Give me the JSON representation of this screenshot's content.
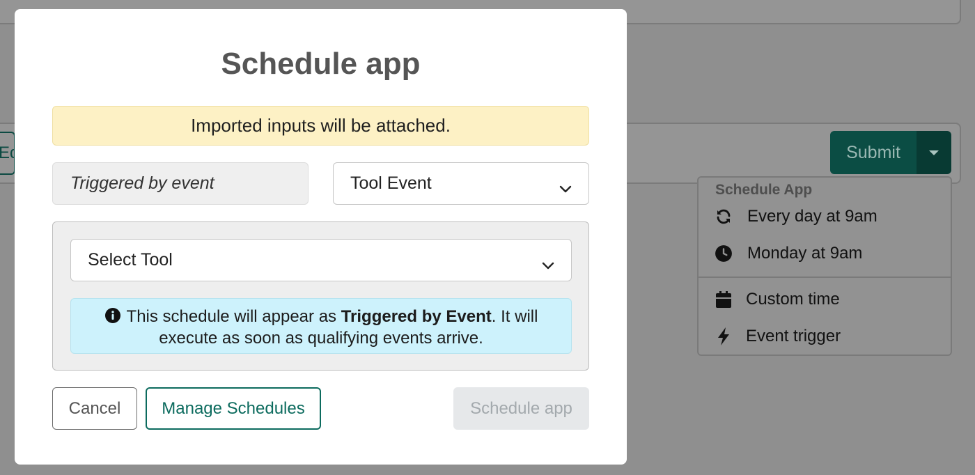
{
  "background": {
    "edit_button_label": "Edit",
    "submit_label": "Submit",
    "schedule_menu": {
      "header": "Schedule App",
      "items": [
        {
          "label": "Every day at 9am",
          "icon": "refresh-icon"
        },
        {
          "label": "Monday at 9am",
          "icon": "clock-icon"
        },
        {
          "label": "Custom time",
          "icon": "calendar-icon"
        },
        {
          "label": "Event trigger",
          "icon": "bolt-icon"
        }
      ]
    }
  },
  "modal": {
    "title": "Schedule app",
    "warning": "Imported inputs will be attached.",
    "trigger_label": "Triggered by event",
    "event_select_value": "Tool Event",
    "tool_select_value": "Select Tool",
    "info": {
      "prefix": "This schedule will appear as ",
      "bold": "Triggered by Event",
      "suffix": ". It will",
      "line2": "execute as soon as qualifying events arrive."
    },
    "buttons": {
      "cancel": "Cancel",
      "manage": "Manage Schedules",
      "schedule": "Schedule app"
    }
  },
  "colors": {
    "primary": "#0c6b5e",
    "warning_bg": "#fdf1c5",
    "info_bg": "#cdf2fc"
  }
}
